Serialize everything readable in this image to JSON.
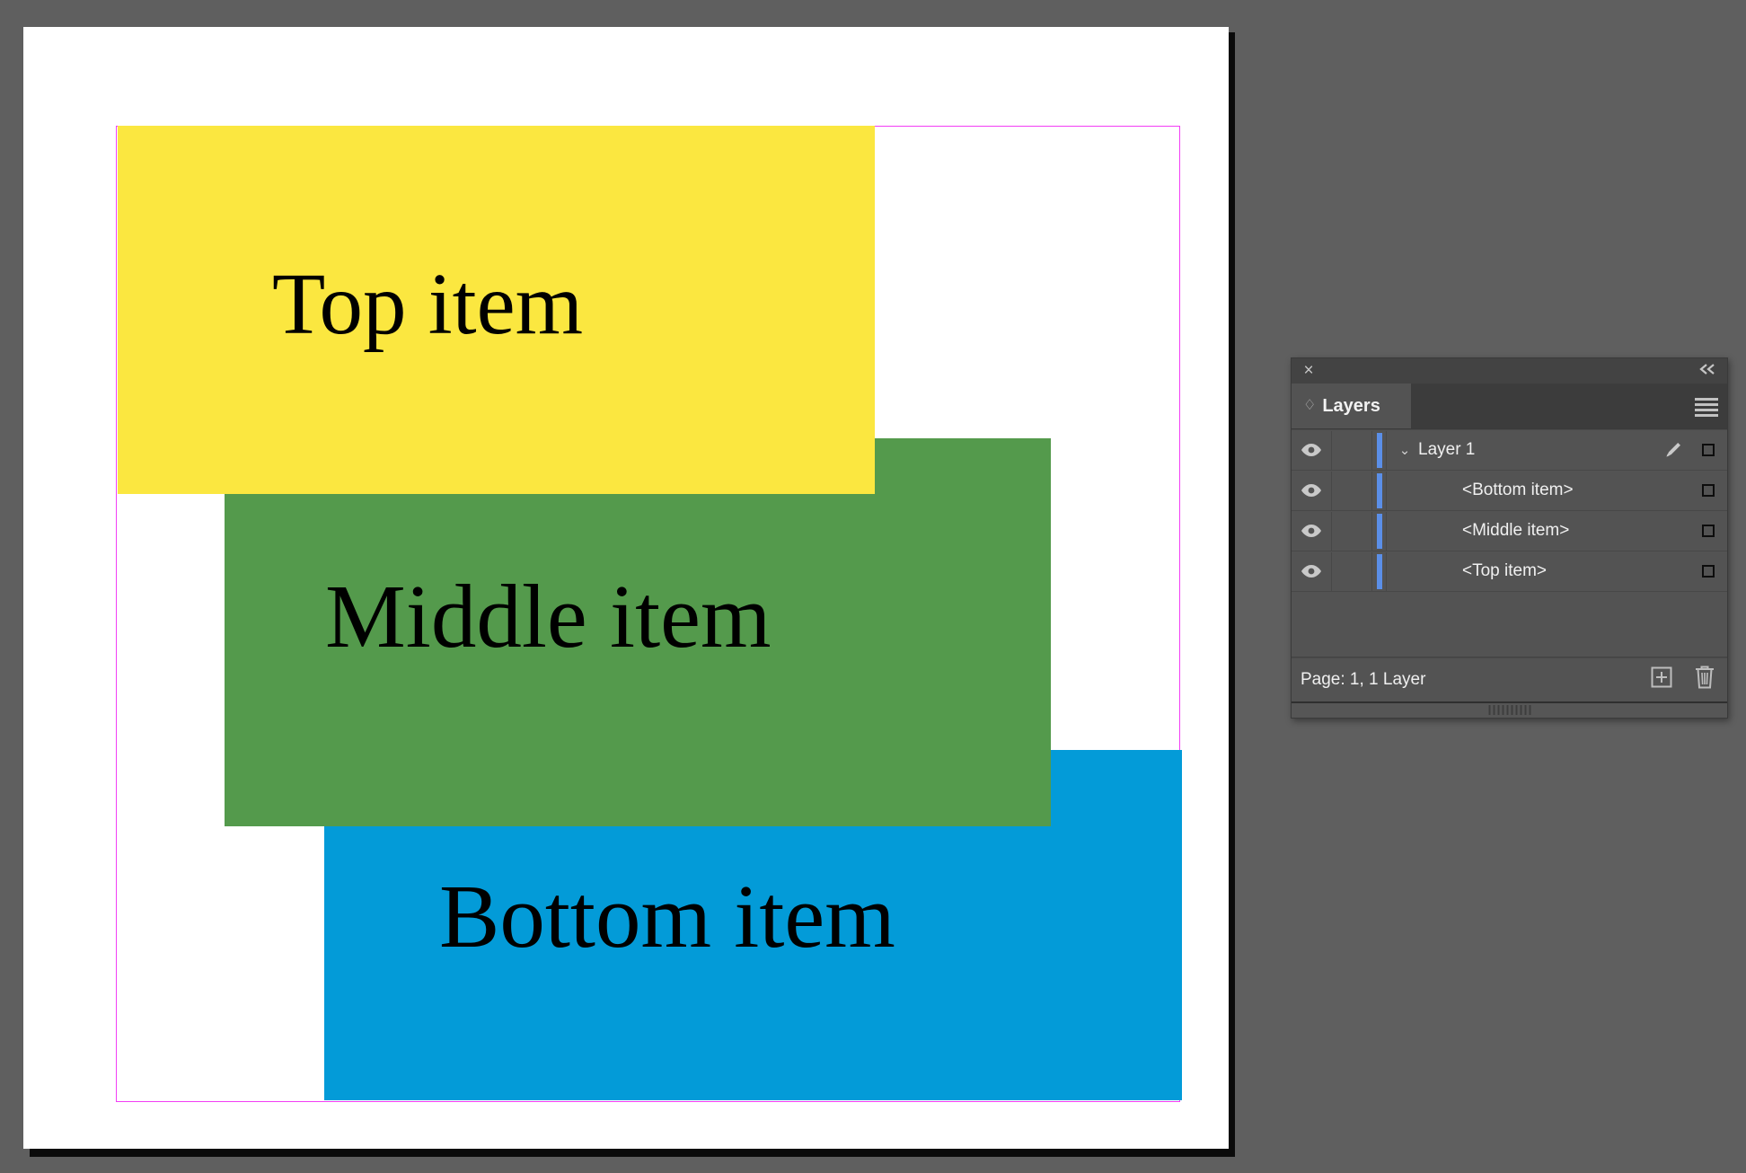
{
  "app": {
    "background_color": "#5f5f5f",
    "page_color": "#ffffff",
    "margin_guide_color": "#f23ef5"
  },
  "artboard": {
    "items": [
      {
        "name": "Top item",
        "label": "Top item",
        "fill": "#fbe740",
        "z": 3
      },
      {
        "name": "Middle item",
        "label": "Middle item",
        "fill": "#549a4c",
        "z": 2
      },
      {
        "name": "Bottom item",
        "label": "Bottom item",
        "fill": "#039bd8",
        "z": 1
      }
    ]
  },
  "panel": {
    "title": "Layers",
    "close_icon": "×",
    "collapse_icon": "«",
    "tab_icon": "♢",
    "menu_icon": "hamburger-menu-icon",
    "color_chip": "#5b8fe8",
    "rows": [
      {
        "name": "Layer 1",
        "type": "layer",
        "visible": true,
        "expanded": true,
        "disclosure": "⌄",
        "has_pen": true,
        "target": "□"
      },
      {
        "name": "<Bottom item>",
        "type": "object",
        "visible": true,
        "expanded": false,
        "disclosure": "",
        "has_pen": false,
        "target": "□"
      },
      {
        "name": "<Middle item>",
        "type": "object",
        "visible": true,
        "expanded": false,
        "disclosure": "",
        "has_pen": false,
        "target": "□"
      },
      {
        "name": "<Top item>",
        "type": "object",
        "visible": true,
        "expanded": false,
        "disclosure": "",
        "has_pen": false,
        "target": "□"
      }
    ],
    "footer": {
      "status": "Page: 1, 1 Layer",
      "new_layer_label": "new-layer-button",
      "delete_label": "delete-layer-button"
    }
  }
}
